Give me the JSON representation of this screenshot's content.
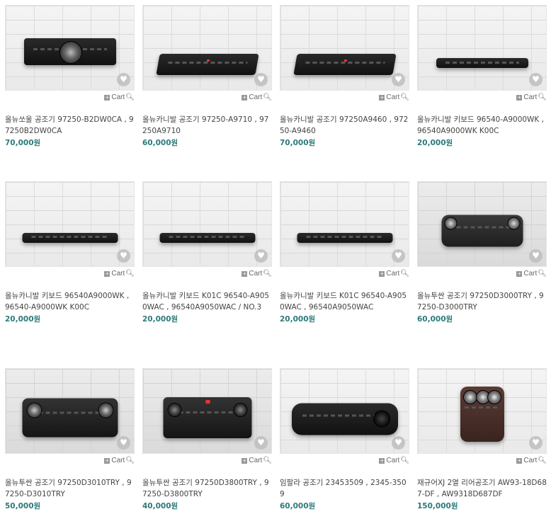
{
  "ui": {
    "cart_label": "Cart",
    "add_icon": "plus-icon",
    "zoom_icon": "magnifier-icon",
    "wishlist_icon": "heart-icon",
    "price_color": "#2c7a7b"
  },
  "products": [
    {
      "title": "올뉴쏘울 공조기 97250-B2DW0CA , 97250B2DW0CA",
      "price": "70,000원"
    },
    {
      "title": "올뉴카니발 공조기 97250-A9710 , 97250A9710",
      "price": "60,000원"
    },
    {
      "title": "올뉴카니발 공조기 97250A9460 , 97250-A9460",
      "price": "70,000원"
    },
    {
      "title": "올뉴카니발 키보드 96540-A9000WK , 96540A9000WK K00C",
      "price": "20,000원"
    },
    {
      "title": "올뉴카니발 키보드 96540A9000WK , 96540-A9000WK K00C",
      "price": "20,000원"
    },
    {
      "title": "올뉴카니발 키보드 K01C 96540-A9050WAC , 96540A9050WAC / NO.3",
      "price": "20,000원"
    },
    {
      "title": "올뉴카니발 키보드 K01C 96540-A9050WAC , 96540A9050WAC",
      "price": "20,000원"
    },
    {
      "title": "올뉴투싼 공조기 97250D3000TRY , 97250-D3000TRY",
      "price": "60,000원"
    },
    {
      "title": "올뉴투싼 공조기 97250D3010TRY , 97250-D3010TRY",
      "price": "50,000원"
    },
    {
      "title": "올뉴투싼 공조기 97250D3800TRY , 97250-D3800TRY",
      "price": "40,000원"
    },
    {
      "title": "임팔라 공조기 23453509 , 2345-3509",
      "price": "60,000원"
    },
    {
      "title": "재규어XJ 2열 리어공조기 AW93-18D687-DF , AW9318D687DF",
      "price": "150,000원"
    }
  ]
}
